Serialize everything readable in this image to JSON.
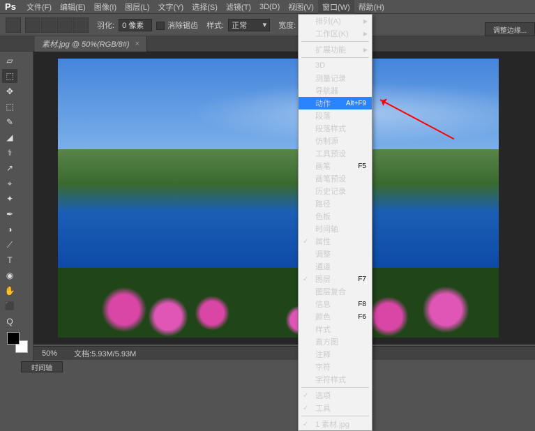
{
  "app": {
    "logo": "Ps"
  },
  "menu": [
    "文件(F)",
    "编辑(E)",
    "图像(I)",
    "图层(L)",
    "文字(Y)",
    "选择(S)",
    "滤镜(T)",
    "3D(D)",
    "视图(V)",
    "窗口(W)",
    "帮助(H)"
  ],
  "open_menu_index": 9,
  "options": {
    "feather_label": "羽化:",
    "feather_value": "0 像素",
    "antialias": "消除锯齿",
    "style_label": "样式:",
    "style_value": "正常",
    "width_label": "宽度:",
    "panel_btn": "调整边缘..."
  },
  "doc_tab": {
    "title": "素材.jpg @ 50%(RGB/8#)",
    "close": "×"
  },
  "status": {
    "zoom": "50%",
    "filesize_label": "文档:",
    "filesize": "5.93M/5.93M"
  },
  "bottom_tab": "时间轴",
  "dropdown": {
    "groups": [
      [
        {
          "label": "排列(A)",
          "arrow": true
        },
        {
          "label": "工作区(K)",
          "arrow": true
        }
      ],
      [
        {
          "label": "扩展功能",
          "arrow": true
        }
      ],
      [
        {
          "label": "3D"
        },
        {
          "label": "测量记录"
        },
        {
          "label": "导航器"
        },
        {
          "label": "动作",
          "shortcut": "Alt+F9",
          "highlight": true
        },
        {
          "label": "段落"
        },
        {
          "label": "段落样式"
        },
        {
          "label": "仿制源"
        },
        {
          "label": "工具预设"
        },
        {
          "label": "画笔",
          "shortcut": "F5"
        },
        {
          "label": "画笔预设"
        },
        {
          "label": "历史记录"
        },
        {
          "label": "路径"
        },
        {
          "label": "色板"
        },
        {
          "label": "时间轴"
        },
        {
          "label": "属性",
          "check": true
        },
        {
          "label": "调整"
        },
        {
          "label": "通道"
        },
        {
          "label": "图层",
          "shortcut": "F7",
          "check": true
        },
        {
          "label": "图层复合"
        },
        {
          "label": "信息",
          "shortcut": "F8"
        },
        {
          "label": "颜色",
          "shortcut": "F6"
        },
        {
          "label": "样式"
        },
        {
          "label": "直方图"
        },
        {
          "label": "注释"
        },
        {
          "label": "字符"
        },
        {
          "label": "字符样式"
        }
      ],
      [
        {
          "label": "选项",
          "check": true
        },
        {
          "label": "工具",
          "check": true
        }
      ],
      [
        {
          "label": "1 素材.jpg",
          "check": true
        }
      ]
    ]
  },
  "tools": [
    "▱",
    "⬚",
    "✥",
    "⬚",
    "✎",
    "◢",
    "⚕",
    "↗",
    "⌖",
    "✦",
    "✒",
    "◑",
    "⟋",
    "T",
    "◉",
    "✋",
    "⬛",
    "Q"
  ]
}
